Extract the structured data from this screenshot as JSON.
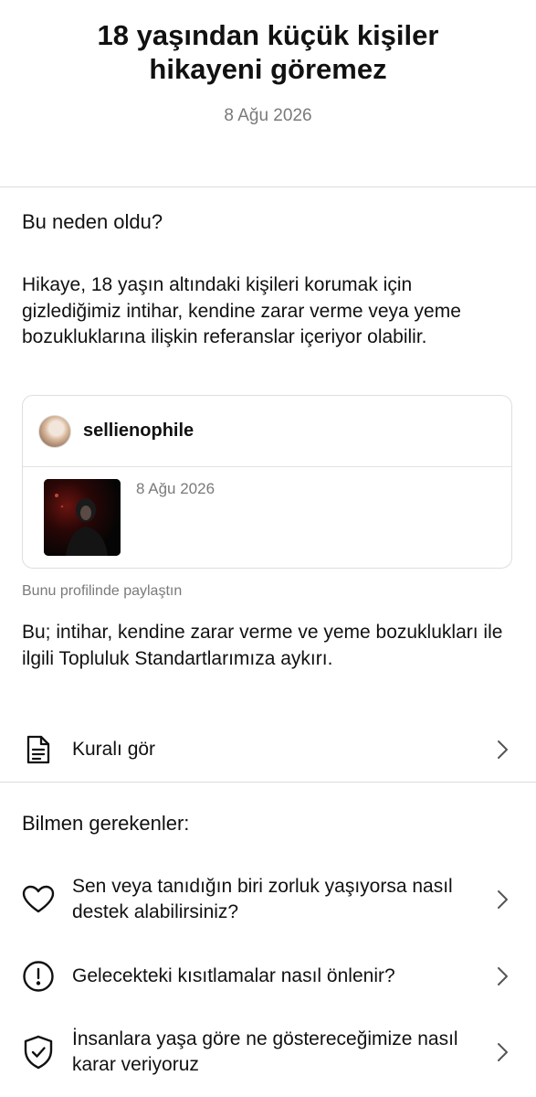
{
  "header": {
    "title": "18 yaşından küçük kişiler hikayeni göremez",
    "date": "8 Ağu 2026"
  },
  "reason": {
    "heading": "Bu neden oldu?",
    "text": "Hikaye, 18 yaşın altındaki kişileri korumak için gizlediğimiz intihar, kendine zarar verme veya yeme bozukluklarına ilişkin referanslar içeriyor olabilir."
  },
  "post": {
    "username": "sellienophile",
    "date": "8 Ağu 2026",
    "caption": "Bunu profilinde paylaştın"
  },
  "violation_text": "Bu; intihar, kendine zarar verme ve yeme bozuklukları ile ilgili Topluluk Standartlarımıza aykırı.",
  "rule_link": {
    "label": "Kuralı gör",
    "icon": "document-icon"
  },
  "info": {
    "heading": "Bilmen gerekenler:",
    "items": [
      {
        "label": "Sen veya tanıdığın biri zorluk yaşıyorsa nasıl destek alabilirsiniz?",
        "icon": "heart-icon"
      },
      {
        "label": "Gelecekteki kısıtlamalar nasıl önlenir?",
        "icon": "alert-circle-icon"
      },
      {
        "label": "İnsanlara yaşa göre ne göstereceğimize nasıl karar veriyoruz",
        "icon": "shield-check-icon"
      }
    ]
  }
}
